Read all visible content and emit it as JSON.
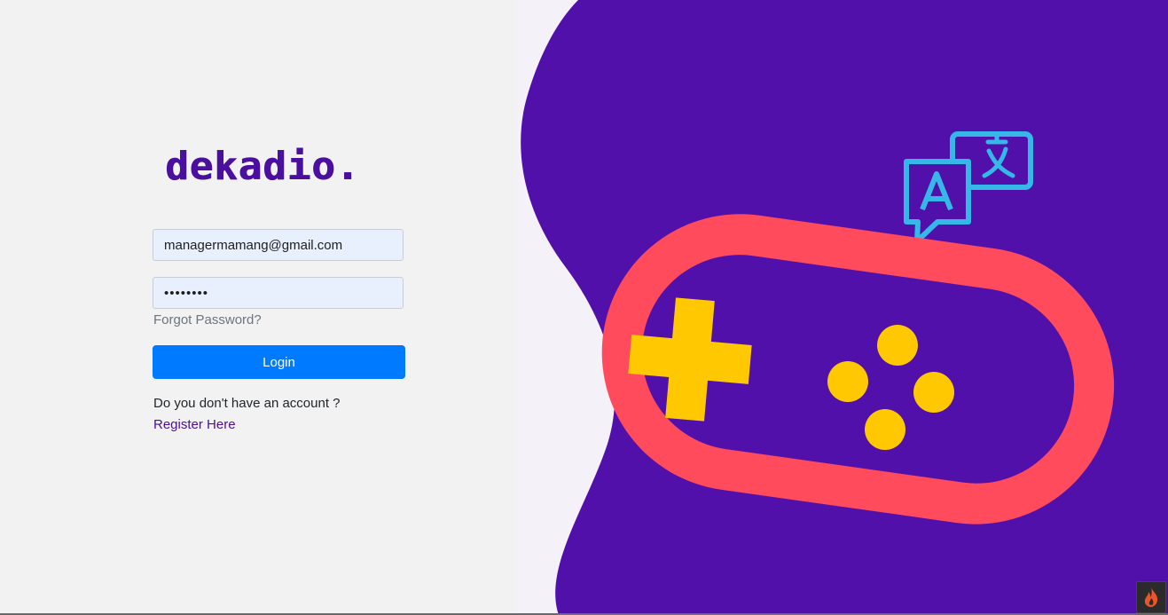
{
  "brand": {
    "logo_text": "dekadio.",
    "logo_color": "#4a0f9e"
  },
  "form": {
    "email_value": "managermamang@gmail.com",
    "password_value": "tidakada",
    "forgot_password_label": "Forgot Password?",
    "login_label": "Login",
    "no_account_text": "Do you don't have an account ?",
    "register_label": "Register Here"
  },
  "illustration": {
    "icons": [
      "translate-icon",
      "gamepad-icon",
      "dpad-icon",
      "action-buttons-icon"
    ]
  },
  "corner_widget": {
    "icon": "flame-icon"
  },
  "colors": {
    "accent_button": "#007bff",
    "panel_purple": "#5210ab",
    "controller_red": "#ff4b5c",
    "controller_yellow": "#ffc800",
    "translate_blue": "#35b7e8",
    "input_background": "#e8f0fe"
  }
}
